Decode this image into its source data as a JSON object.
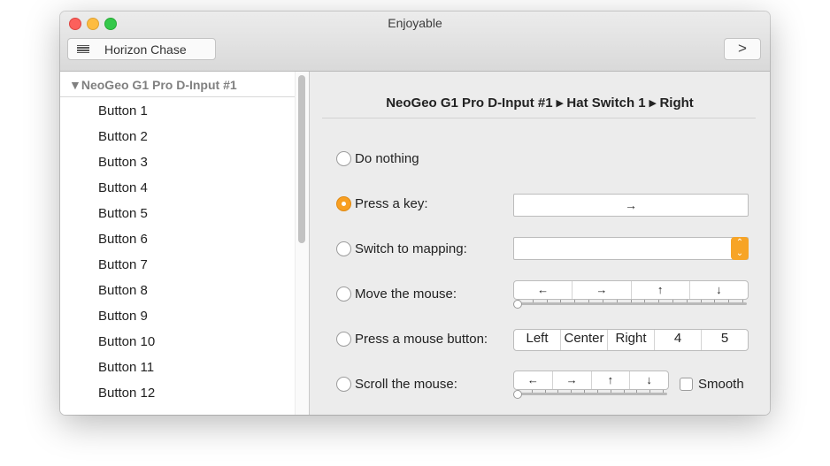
{
  "window": {
    "title": "Enjoyable"
  },
  "toolbar": {
    "mapping_label": "Horizon Chase",
    "next_label": ">"
  },
  "sidebar": {
    "device": "NeoGeo G1 Pro D-Input #1",
    "items": [
      "Button 1",
      "Button 2",
      "Button 3",
      "Button 4",
      "Button 5",
      "Button 6",
      "Button 7",
      "Button 8",
      "Button 9",
      "Button 10",
      "Button 11",
      "Button 12"
    ]
  },
  "main": {
    "breadcrumb": "NeoGeo G1 Pro D-Input #1 ▸ Hat Switch 1 ▸ Right",
    "options": {
      "do_nothing": "Do nothing",
      "press_key": "Press a key:",
      "switch_mapping": "Switch to mapping:",
      "move_mouse": "Move the mouse:",
      "press_mouse": "Press a mouse button:",
      "scroll_mouse": "Scroll the mouse:"
    },
    "selected_option": "press_key",
    "key_field_value": "→",
    "switch_mapping_value": "",
    "move_dirs": [
      "←",
      "→",
      "↑",
      "↓"
    ],
    "mouse_buttons": [
      "Left",
      "Center",
      "Right",
      "4",
      "5"
    ],
    "scroll_dirs": [
      "←",
      "→",
      "↑",
      "↓"
    ],
    "smooth_label": "Smooth",
    "smooth_checked": false,
    "move_speed": 0,
    "scroll_speed": 0
  },
  "colors": {
    "accent": "#f89f22",
    "close": "#fc605c",
    "minimize": "#fdbc40",
    "maximize": "#34c84a"
  }
}
